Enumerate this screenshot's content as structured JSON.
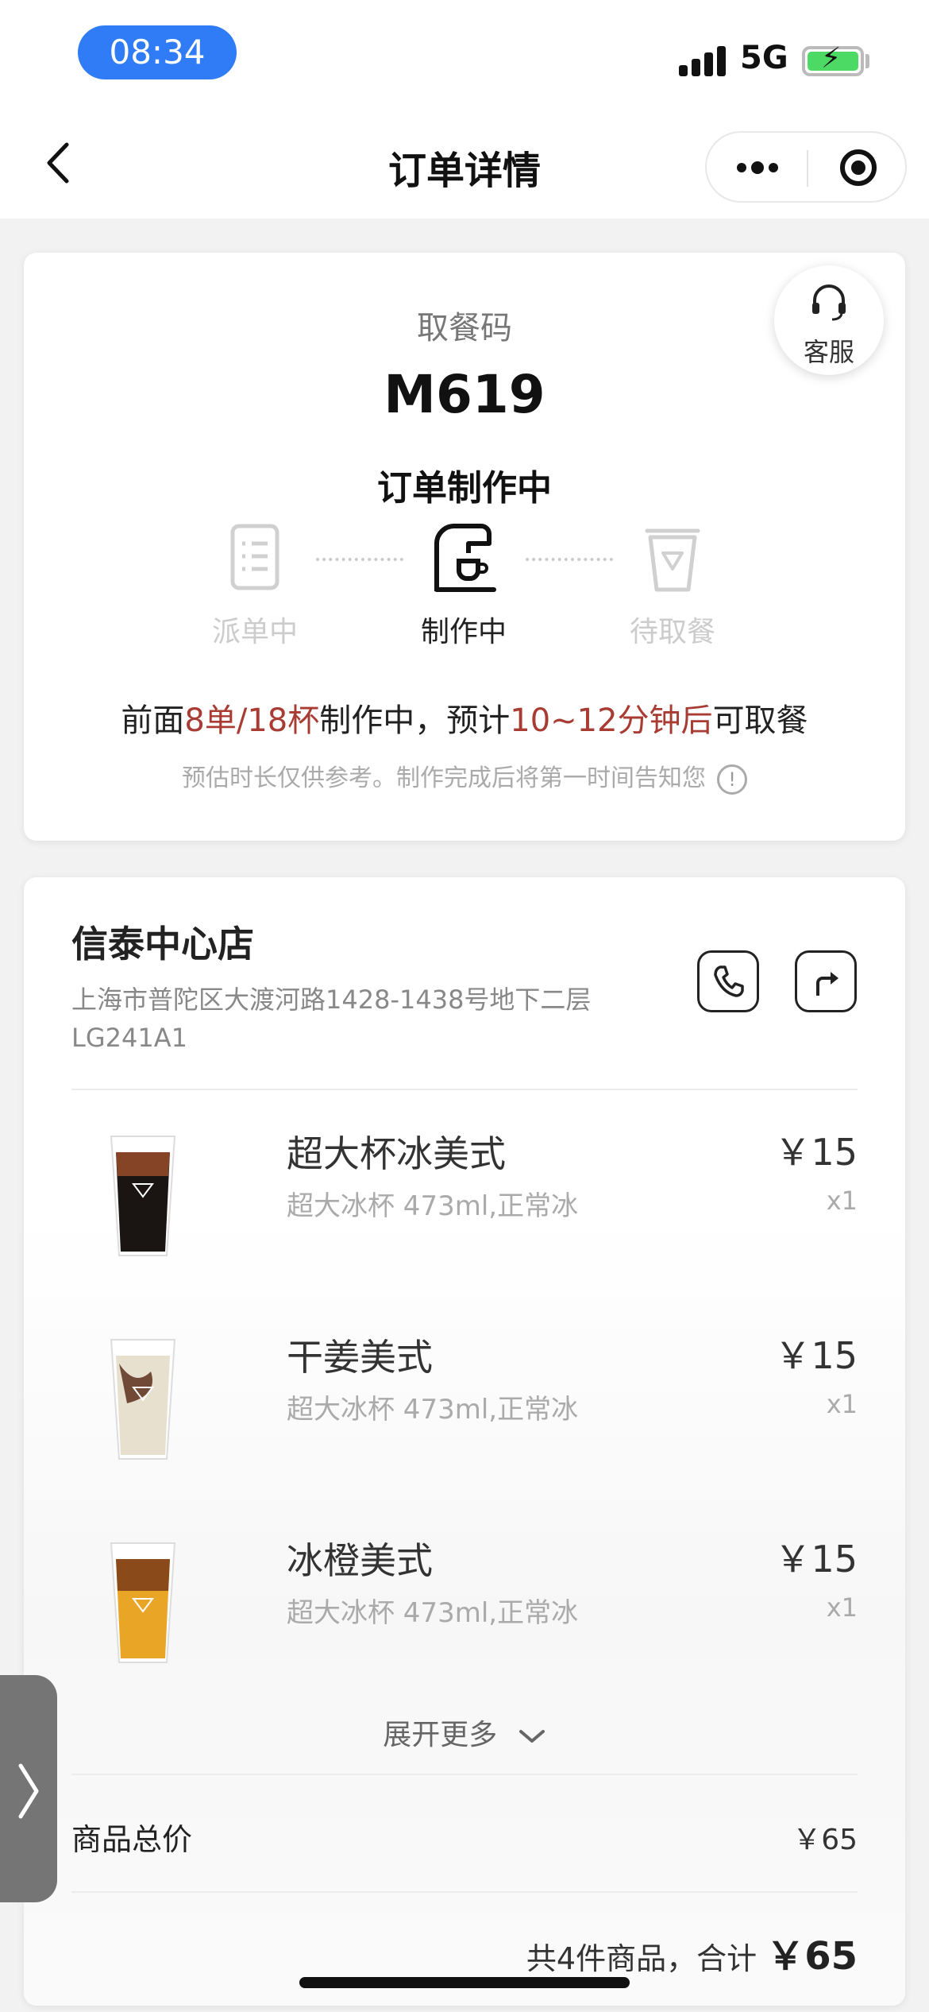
{
  "status_bar": {
    "time": "08:34",
    "network": "5G",
    "icons": [
      "signal-icon",
      "battery-charging-icon"
    ]
  },
  "nav": {
    "title": "订单详情",
    "back_icon": "chevron-left-icon",
    "more_icon": "more-dots-icon",
    "close_icon": "target-close-icon"
  },
  "pickup": {
    "label": "取餐码",
    "code": "M619",
    "status": "订单制作中",
    "service_label": "客服",
    "steps": [
      {
        "label": "派单中",
        "icon": "order-list-icon",
        "active": false
      },
      {
        "label": "制作中",
        "icon": "coffee-machine-icon",
        "active": true
      },
      {
        "label": "待取餐",
        "icon": "cup-icon",
        "active": false
      }
    ],
    "queue": {
      "prefix": "前面",
      "count": "8单/18杯",
      "middle": "制作中，预计",
      "eta": "10~12分钟后",
      "suffix": "可取餐"
    },
    "note": "预估时长仅供参考。制作完成后将第一时间告知您",
    "note_icon": "!"
  },
  "store": {
    "name": "信泰中心店",
    "address": "上海市普陀区大渡河路1428-1438号地下二层LG241A1",
    "phone_icon": "phone-icon",
    "navigate_icon": "navigate-arrow-icon"
  },
  "items": [
    {
      "name": "超大杯冰美式",
      "spec": "超大冰杯 473ml,正常冰",
      "price": "￥15",
      "qty": "x1",
      "color": "#1a1412"
    },
    {
      "name": "干姜美式",
      "spec": "超大冰杯 473ml,正常冰",
      "price": "￥15",
      "qty": "x1",
      "color": "#e8e0cf"
    },
    {
      "name": "冰橙美式",
      "spec": "超大冰杯 473ml,正常冰",
      "price": "￥15",
      "qty": "x1",
      "color": "#e9a526"
    }
  ],
  "expand_label": "展开更多",
  "summary": {
    "subtotal_label": "商品总价",
    "subtotal_value": "￥65",
    "total_prefix": "共4件商品，合计",
    "total_amount": "￥65"
  },
  "colors": {
    "accent_blue": "#2f7cf6",
    "highlight_red": "#a83b32",
    "battery_green": "#4cd964"
  }
}
